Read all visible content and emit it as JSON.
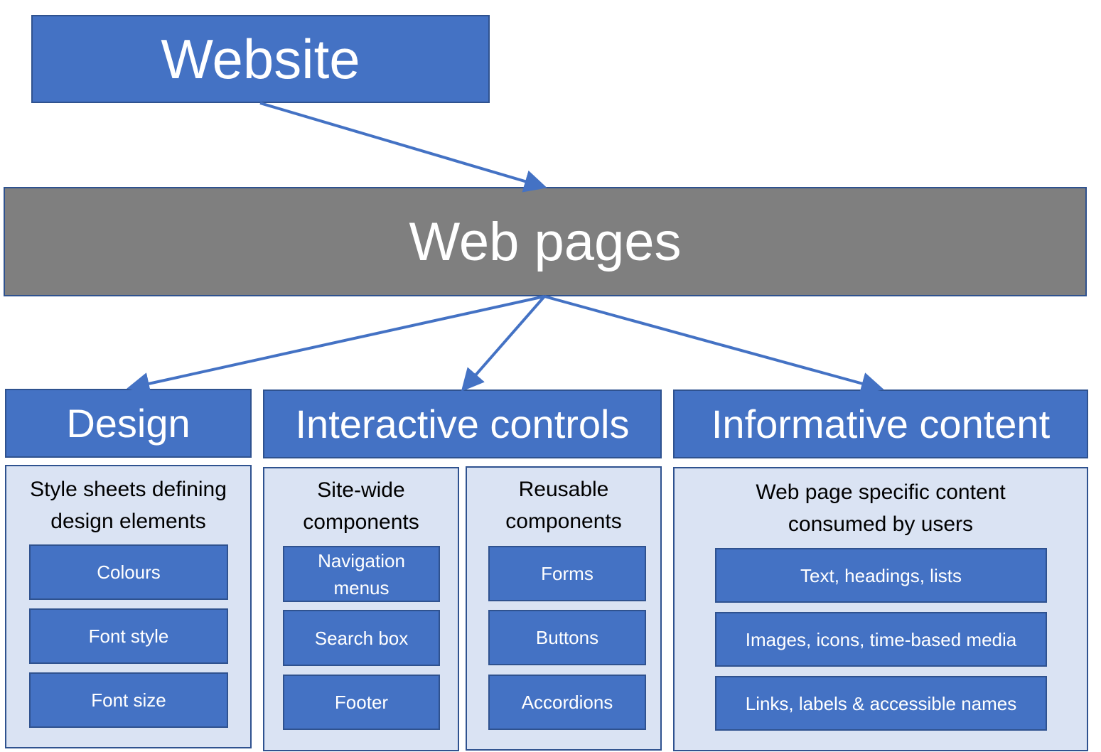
{
  "colors": {
    "box_fill": "#4472C4",
    "box_border": "#2F528F",
    "webpages_fill": "#7F7F7F",
    "panel_fill": "#DAE3F3",
    "arrow": "#4472C4"
  },
  "website": {
    "label": "Website"
  },
  "webpages": {
    "label": "Web pages"
  },
  "categories": [
    {
      "label": "Design"
    },
    {
      "label": "Interactive controls"
    },
    {
      "label": "Informative content"
    }
  ],
  "panels": {
    "design": {
      "title": "Style sheets defining design elements",
      "items": [
        "Colours",
        "Font style",
        "Font size"
      ]
    },
    "site_wide": {
      "title": "Site-wide components",
      "items": [
        "Navigation menus",
        "Search box",
        "Footer"
      ]
    },
    "reusable": {
      "title": "Reusable components",
      "items": [
        "Forms",
        "Buttons",
        "Accordions"
      ]
    },
    "informative": {
      "title": "Web page specific content consumed by users",
      "items": [
        "Text, headings, lists",
        "Images, icons, time-based media",
        "Links, labels & accessible names"
      ]
    }
  },
  "edges": [
    {
      "from": "Website",
      "to": "Web pages"
    },
    {
      "from": "Web pages",
      "to": "Design"
    },
    {
      "from": "Web pages",
      "to": "Interactive controls"
    },
    {
      "from": "Web pages",
      "to": "Informative content"
    }
  ]
}
